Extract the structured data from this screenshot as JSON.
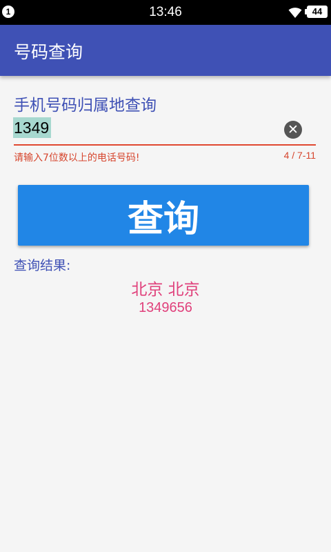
{
  "status_bar": {
    "notification_count": "1",
    "time": "13:46",
    "battery": "44"
  },
  "app_bar": {
    "title": "号码查询"
  },
  "form": {
    "hint": "手机号码归属地查询",
    "phone_value": "1349",
    "error": "请输入7位数以上的电话号码!",
    "counter": "4 / 7-11"
  },
  "query_button": {
    "label": "查询"
  },
  "result": {
    "label": "查询结果:",
    "location": "北京 北京",
    "number": "1349656"
  },
  "colors": {
    "primary": "#3f51b5",
    "button": "#2186e6",
    "error": "#d6452d",
    "result_text": "#e0407b",
    "selection": "#a7d8cf"
  },
  "icons": [
    "wifi-icon",
    "clear-icon"
  ]
}
